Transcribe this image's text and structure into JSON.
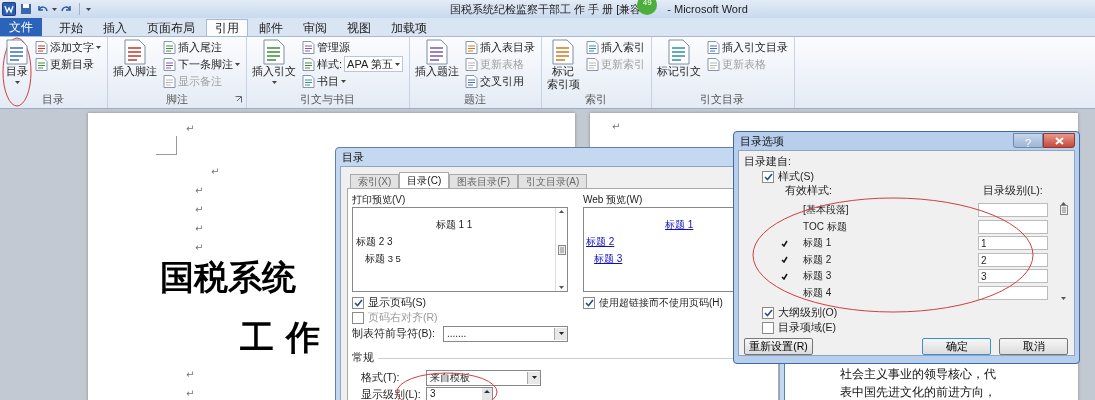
{
  "window": {
    "title": "国税系统纪检监察干部工 作 手 册 [兼容",
    "badge": "49",
    "title_end": "- Microsoft Word"
  },
  "tabs": [
    {
      "label": "文件",
      "kind": "file",
      "selected": false
    },
    {
      "label": "开始",
      "kind": "tab",
      "selected": false
    },
    {
      "label": "插入",
      "kind": "tab",
      "selected": false
    },
    {
      "label": "页面布局",
      "kind": "tab",
      "selected": false
    },
    {
      "label": "引用",
      "kind": "tab",
      "selected": true
    },
    {
      "label": "邮件",
      "kind": "tab",
      "selected": false
    },
    {
      "label": "审阅",
      "kind": "tab",
      "selected": false
    },
    {
      "label": "视图",
      "kind": "tab",
      "selected": false
    },
    {
      "label": "加载项",
      "kind": "tab",
      "selected": false
    }
  ],
  "ribbon": {
    "groups": [
      {
        "label": "目录",
        "launcher": false,
        "large": [
          {
            "label": "目录",
            "menu": true
          }
        ],
        "small": [
          {
            "kind": "button",
            "label": "添加文字",
            "menu": true,
            "disabled": false
          },
          {
            "kind": "button",
            "label": "更新目录",
            "menu": false,
            "disabled": false
          }
        ]
      },
      {
        "label": "脚注",
        "launcher": true,
        "large": [
          {
            "label": "插入脚注",
            "menu": false
          }
        ],
        "small": [
          {
            "kind": "button",
            "label": "插入尾注",
            "menu": false,
            "disabled": false
          },
          {
            "kind": "button",
            "label": "下一条脚注",
            "menu": true,
            "disabled": false
          },
          {
            "kind": "button",
            "label": "显示备注",
            "menu": false,
            "disabled": true
          }
        ]
      },
      {
        "label": "引文与书目",
        "launcher": false,
        "large": [
          {
            "label": "插入引文",
            "menu": true
          }
        ],
        "small": [
          {
            "kind": "button",
            "label": "管理源",
            "menu": false,
            "disabled": false
          },
          {
            "kind": "dropdown",
            "label": "样式:",
            "value": "APA 第五",
            "menu": true,
            "disabled": false
          },
          {
            "kind": "button",
            "label": "书目",
            "menu": true,
            "disabled": false
          }
        ]
      },
      {
        "label": "题注",
        "launcher": false,
        "large": [
          {
            "label": "插入题注",
            "menu": false
          }
        ],
        "small": [
          {
            "kind": "button",
            "label": "插入表目录",
            "menu": false,
            "disabled": false
          },
          {
            "kind": "button",
            "label": "更新表格",
            "menu": false,
            "disabled": true
          },
          {
            "kind": "button",
            "label": "交叉引用",
            "menu": false,
            "disabled": false
          }
        ]
      },
      {
        "label": "索引",
        "launcher": false,
        "large": [
          {
            "label": [
              "标记",
              "索引项"
            ]
          }
        ],
        "small": [
          {
            "kind": "button",
            "label": "插入索引",
            "menu": false,
            "disabled": false
          },
          {
            "kind": "button",
            "label": "更新索引",
            "menu": false,
            "disabled": true
          }
        ]
      },
      {
        "label": "引文目录",
        "launcher": false,
        "large": [
          {
            "label": "标记引文",
            "menu": false
          }
        ],
        "small": [
          {
            "kind": "button",
            "label": "插入引文目录",
            "menu": false,
            "disabled": false
          },
          {
            "kind": "button",
            "label": "更新表格",
            "menu": false,
            "disabled": true
          }
        ]
      }
    ]
  },
  "document": {
    "pages": [
      {
        "lines": [
          {
            "kind": "mark",
            "text": "↵"
          },
          {
            "kind": "mark",
            "text": "↵"
          },
          {
            "kind": "mark",
            "text": "↵"
          },
          {
            "kind": "mark",
            "text": "↵"
          },
          {
            "kind": "mark",
            "text": "↵"
          },
          {
            "kind": "mark",
            "text": "↵"
          },
          {
            "kind": "title",
            "text": "国税系统"
          },
          {
            "kind": "title",
            "text": "工 作"
          },
          {
            "kind": "mark",
            "text": "↵"
          },
          {
            "kind": "mark",
            "text": "↵"
          }
        ]
      },
      {
        "lines": [
          {
            "kind": "mark",
            "text": "↵"
          },
          {
            "kind": "body",
            "text": "社会主义事业的领导核心，代"
          },
          {
            "kind": "body",
            "text": "表中国先进文化的前进方向，"
          }
        ]
      }
    ]
  },
  "toc_dialog": {
    "title": "目录",
    "tabs": [
      {
        "label": "索引(X)",
        "selected": false
      },
      {
        "label": "目录(C)",
        "selected": true
      },
      {
        "label": "图表目录(F)",
        "selected": false
      },
      {
        "label": "引文目录(A)",
        "selected": false
      }
    ],
    "print_preview": {
      "label": "打印预览(V)",
      "lines": [
        {
          "kind": "h1",
          "text": "标题 1 1"
        },
        {
          "kind": "h2",
          "text": "标题 2 3"
        },
        {
          "kind": "h3",
          "text": "标题 3 5"
        }
      ]
    },
    "options": [
      {
        "label": "显示页码(S)",
        "checked": true,
        "disabled": false
      },
      {
        "label": "页码右对齐(R)",
        "checked": false,
        "disabled": true
      }
    ],
    "tab_leader": {
      "label": "制表符前导符(B):",
      "value": "......."
    },
    "web_preview": {
      "label": "Web 预览(W)",
      "links": [
        {
          "kind": "h1",
          "text": "标题 1"
        },
        {
          "kind": "h2",
          "text": "标题 2"
        },
        {
          "kind": "h3",
          "text": "标题 3"
        }
      ]
    },
    "hyperlink_option": {
      "label": "使用超链接而不使用页码(H)",
      "checked": true
    },
    "general": {
      "label": "常规",
      "format": {
        "label": "格式(T):",
        "value": "来自模板"
      },
      "levels": {
        "label": "显示级别(L):",
        "value": "3"
      }
    }
  },
  "options_dialog": {
    "title": "目录选项",
    "help": "?",
    "build_from": "目录建自:",
    "styles_option": {
      "label": "样式(S)",
      "checked": true
    },
    "col_styles": "有效样式:",
    "col_level": "目录级别(L):",
    "styles": [
      {
        "name": "[基本段落]",
        "checked": false
      },
      {
        "name": "TOC 标题",
        "checked": false
      },
      {
        "name": "标题 1",
        "checked": true,
        "toc_level": "1"
      },
      {
        "name": "标题 2",
        "checked": true,
        "toc_level": "2"
      },
      {
        "name": "标题 3",
        "checked": true,
        "toc_level": "3"
      },
      {
        "name": "标题 4",
        "checked": false
      }
    ],
    "outline_option": {
      "label": "大纲级别(O)",
      "checked": true
    },
    "fields_option": {
      "label": "目录项域(E)",
      "checked": false
    },
    "buttons": [
      {
        "label": "重新设置(R)",
        "kind": "reset"
      },
      {
        "label": "确定",
        "kind": "default"
      },
      {
        "label": "取消",
        "kind": "cancel"
      }
    ]
  }
}
